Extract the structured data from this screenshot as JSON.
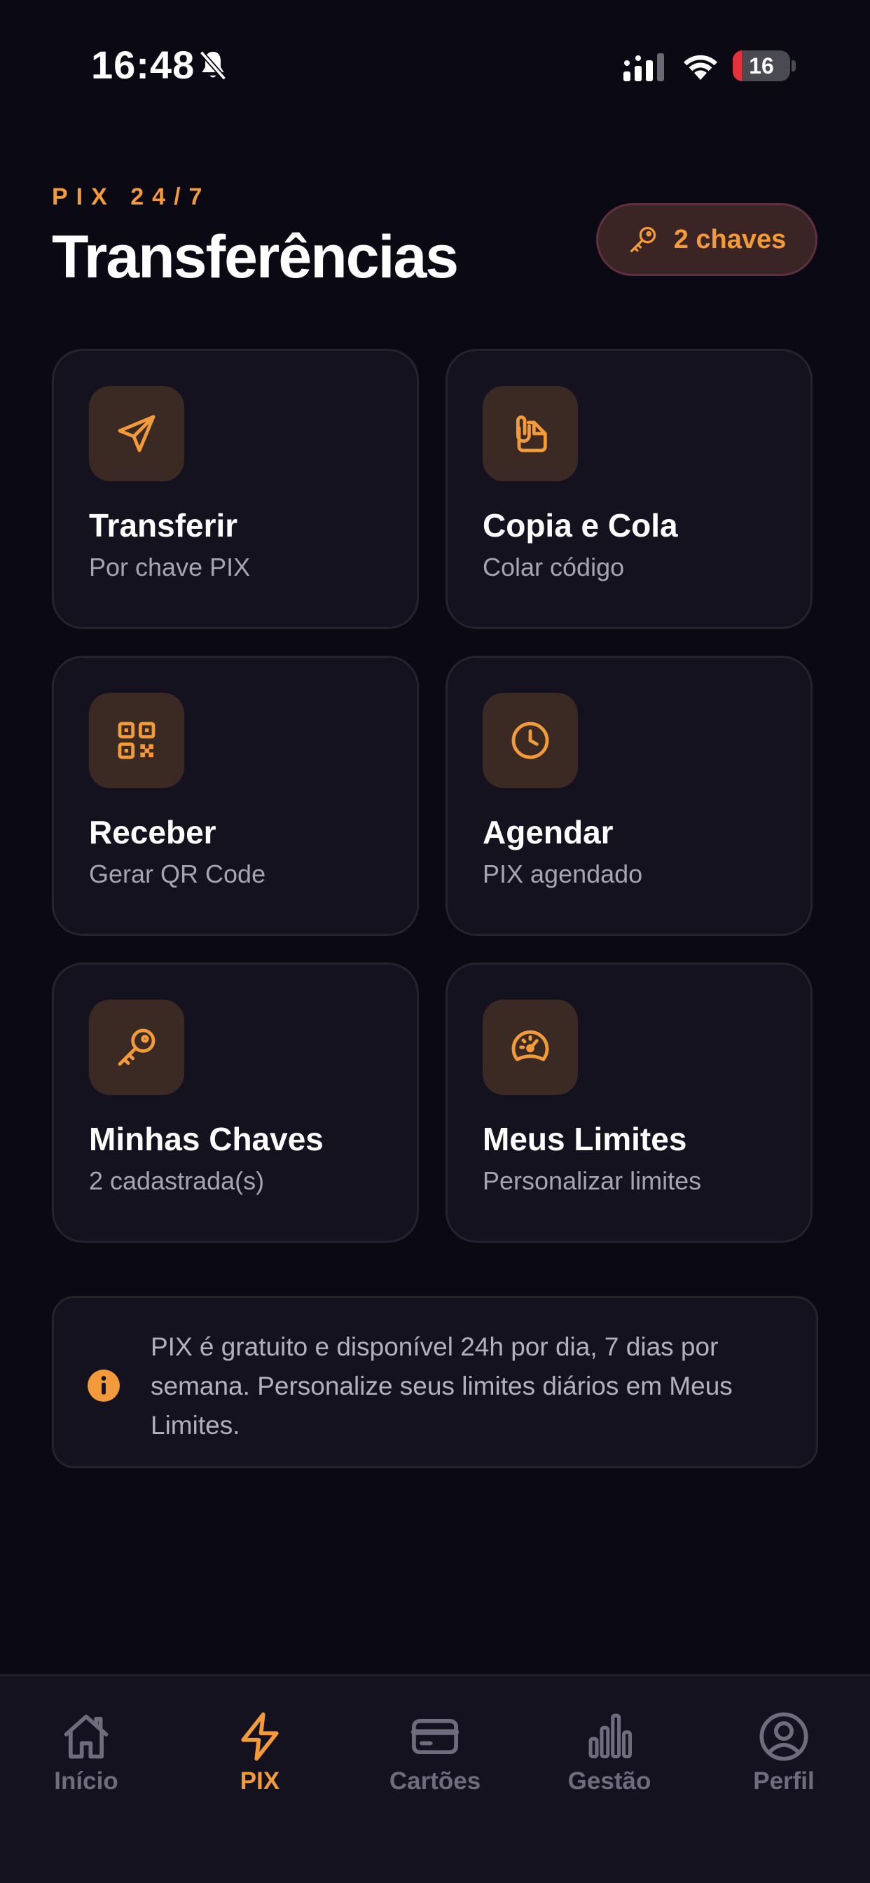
{
  "status_bar": {
    "time": "16:48",
    "battery_level": "16",
    "battery_fraction": 0.16,
    "icons": [
      "bell-off-icon",
      "cellular-signal-icon",
      "wifi-icon",
      "battery-icon"
    ]
  },
  "header": {
    "eyebrow": "PIX 24/7",
    "title": "Transferências",
    "keys_badge": {
      "label": "2 chaves",
      "icon": "key-icon"
    }
  },
  "actions": [
    {
      "title": "Transferir",
      "subtitle": "Por chave PIX",
      "icon": "send-icon"
    },
    {
      "title": "Copia e Cola",
      "subtitle": "Colar código",
      "icon": "clipboard-icon"
    },
    {
      "title": "Receber",
      "subtitle": "Gerar QR Code",
      "icon": "qr-code-icon"
    },
    {
      "title": "Agendar",
      "subtitle": "PIX agendado",
      "icon": "clock-icon"
    },
    {
      "title": "Minhas Chaves",
      "subtitle": "2 cadastrada(s)",
      "icon": "key-icon"
    },
    {
      "title": "Meus Limites",
      "subtitle": "Personalizar limites",
      "icon": "gauge-icon"
    }
  ],
  "info": {
    "icon": "info-icon",
    "text": "PIX é gratuito e disponível 24h por dia, 7 dias por semana. Personalize seus limites diários em Meus Limites."
  },
  "tab_bar": {
    "active": "PIX",
    "tabs": [
      {
        "label": "Início",
        "icon": "home-icon"
      },
      {
        "label": "PIX",
        "icon": "bolt-icon"
      },
      {
        "label": "Cartões",
        "icon": "card-icon"
      },
      {
        "label": "Gestão",
        "icon": "bar-chart-icon"
      },
      {
        "label": "Perfil",
        "icon": "profile-icon"
      }
    ]
  },
  "colors": {
    "background": "#0b0913",
    "card": "#15121f",
    "accent": "#f39b3a",
    "icon_tile": "#3b2a23",
    "muted_text": "#a7a4b2",
    "inactive_tab": "#6f6c7e"
  }
}
